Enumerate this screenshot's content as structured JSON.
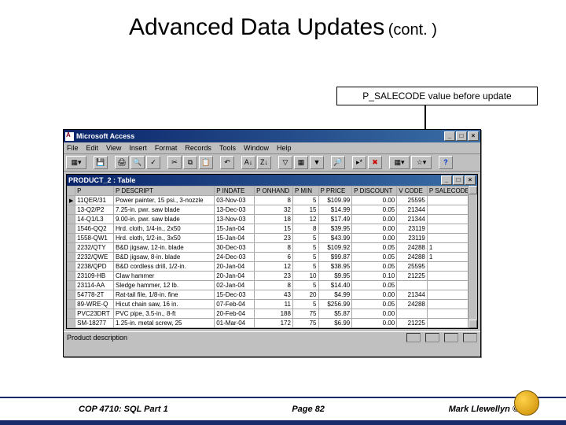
{
  "title_main": "Advanced Data Updates",
  "title_cont": "(cont. )",
  "callout": "P_SALECODE value before update",
  "access": {
    "app_title": "Microsoft Access",
    "menus": [
      "File",
      "Edit",
      "View",
      "Insert",
      "Format",
      "Records",
      "Tools",
      "Window",
      "Help"
    ],
    "inner_title": "PRODUCT_2 : Table",
    "columns": [
      "",
      "P",
      "P DESCRIPT",
      "P INDATE",
      "P ONHAND",
      "P MIN",
      "P PRICE",
      "P DISCOUNT",
      "V CODE",
      "P SALECODE"
    ],
    "rows": [
      [
        "11QER/31",
        "Power painter, 15 psi., 3-nozzle",
        "03-Nov-03",
        "8",
        "5",
        "$109.99",
        "0.00",
        "25595",
        ""
      ],
      [
        "13-Q2/P2",
        "7.25-in. pwr. saw blade",
        "13-Dec-03",
        "32",
        "15",
        "$14.99",
        "0.05",
        "21344",
        ""
      ],
      [
        "14-Q1/L3",
        "9.00-in. pwr. saw blade",
        "13-Nov-03",
        "18",
        "12",
        "$17.49",
        "0.00",
        "21344",
        ""
      ],
      [
        "1546-QQ2",
        "Hrd. cloth, 1/4-in., 2x50",
        "15-Jan-04",
        "15",
        "8",
        "$39.95",
        "0.00",
        "23119",
        ""
      ],
      [
        "1558-QW1",
        "Hrd. cloth, 1/2-in., 3x50",
        "15-Jan-04",
        "23",
        "5",
        "$43.99",
        "0.00",
        "23119",
        ""
      ],
      [
        "2232/QTY",
        "B&D jigsaw, 12-in. blade",
        "30-Dec-03",
        "8",
        "5",
        "$109.92",
        "0.05",
        "24288",
        "1"
      ],
      [
        "2232/QWE",
        "B&D jigsaw, 8-in. blade",
        "24-Dec-03",
        "6",
        "5",
        "$99.87",
        "0.05",
        "24288",
        "1"
      ],
      [
        "2238/QPD",
        "B&D cordless drill, 1/2-in.",
        "20-Jan-04",
        "12",
        "5",
        "$38.95",
        "0.05",
        "25595",
        ""
      ],
      [
        "23109-HB",
        "Claw hammer",
        "20-Jan-04",
        "23",
        "10",
        "$9.95",
        "0.10",
        "21225",
        ""
      ],
      [
        "23114-AA",
        "Sledge hammer, 12 lb.",
        "02-Jan-04",
        "8",
        "5",
        "$14.40",
        "0.05",
        "",
        ""
      ],
      [
        "54778-2T",
        "Rat-tail file, 1/8-in. fine",
        "15-Dec-03",
        "43",
        "20",
        "$4.99",
        "0.00",
        "21344",
        ""
      ],
      [
        "89-WRE-Q",
        "Hicut chain saw, 16 in.",
        "07-Feb-04",
        "11",
        "5",
        "$256.99",
        "0.05",
        "24288",
        ""
      ],
      [
        "PVC23DRT",
        "PVC pipe, 3.5-in., 8-ft",
        "20-Feb-04",
        "188",
        "75",
        "$5.87",
        "0.00",
        "",
        ""
      ],
      [
        "SM-18277",
        "1.25-in. metal screw, 25",
        "01-Mar-04",
        "172",
        "75",
        "$6.99",
        "0.00",
        "21225",
        ""
      ]
    ],
    "status_label": "Product description"
  },
  "footer": {
    "left": "COP 4710: SQL Part 1",
    "center": "Page 82",
    "right": "Mark Llewellyn ©"
  }
}
